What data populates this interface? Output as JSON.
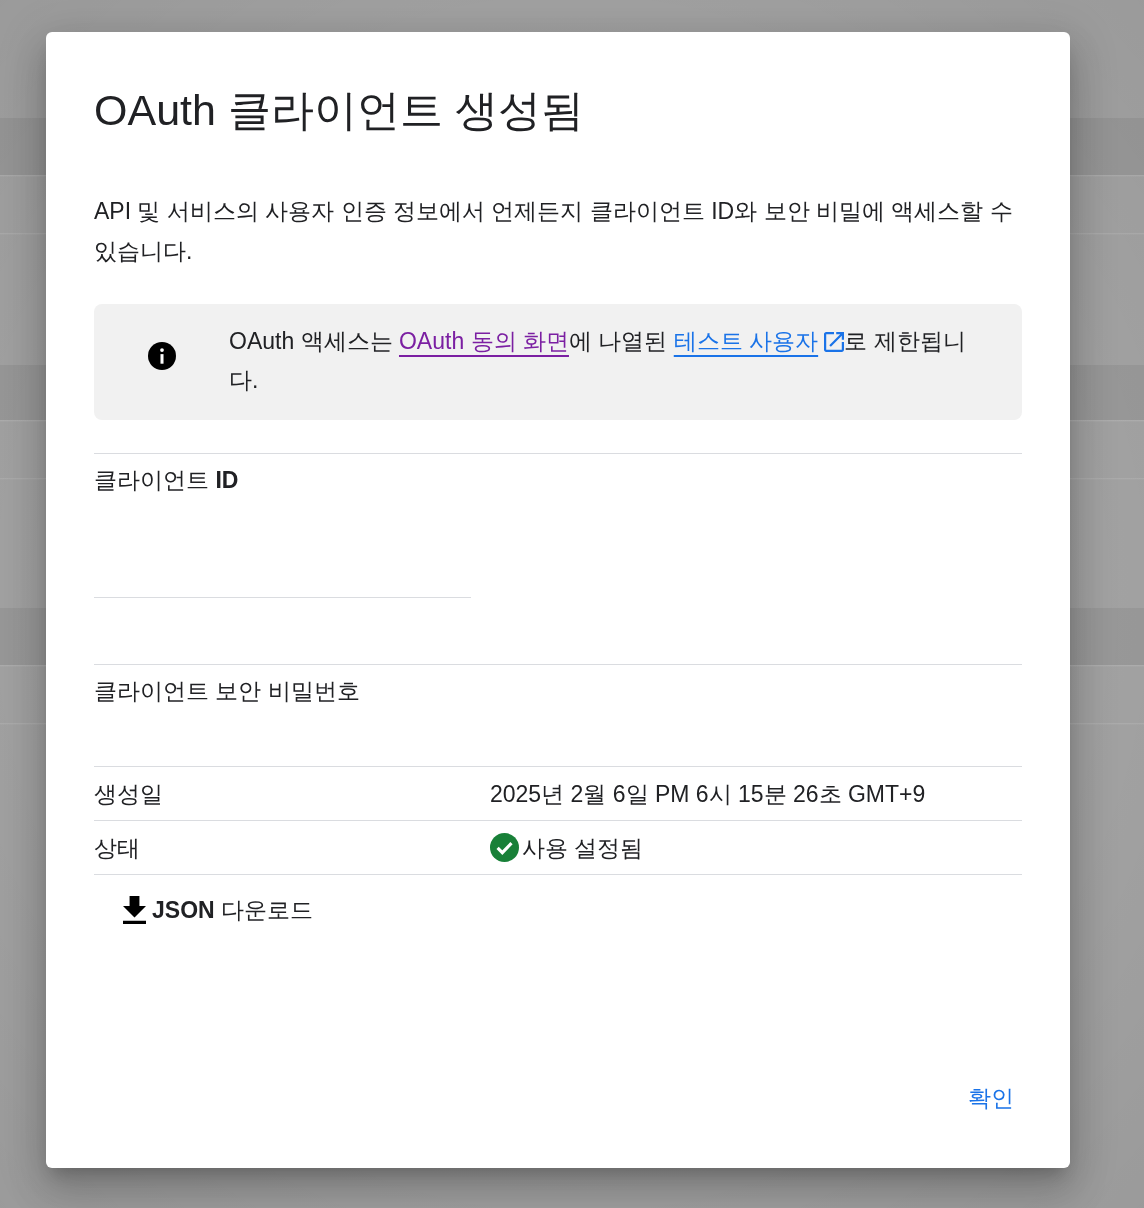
{
  "dialog": {
    "title": "OAuth 클라이언트 생성됨",
    "description": "API 및 서비스의 사용자 인증 정보에서 언제든지 클라이언트 ID와 보안 비밀에 액세스할 수 있습니다.",
    "notice": {
      "parts": [
        {
          "kind": "text",
          "text": "OAuth 액세스는 "
        },
        {
          "kind": "link",
          "text": "OAuth 동의 화면",
          "visited": true,
          "external": false
        },
        {
          "kind": "text",
          "text": "에 나열된 "
        },
        {
          "kind": "link",
          "text": "테스트 사용자",
          "visited": false,
          "external": true
        },
        {
          "kind": "text",
          "text": "로 제한됩니다."
        }
      ]
    },
    "fields": [
      {
        "kind": "input",
        "label": "클라이언트 **ID**"
      },
      {
        "kind": "plain",
        "label": "클라이언트 보안 비밀번호"
      }
    ],
    "details": [
      {
        "kind": "text",
        "label": "생성일",
        "value": "2025년 2월 6일 PM 6시 15분 26초 GMT+9"
      },
      {
        "kind": "status",
        "label": "상태",
        "value": "사용 설정됨"
      }
    ],
    "download_button": {
      "label": "**JSON** 다운로드"
    },
    "ok_button": {
      "label": "확인"
    }
  }
}
